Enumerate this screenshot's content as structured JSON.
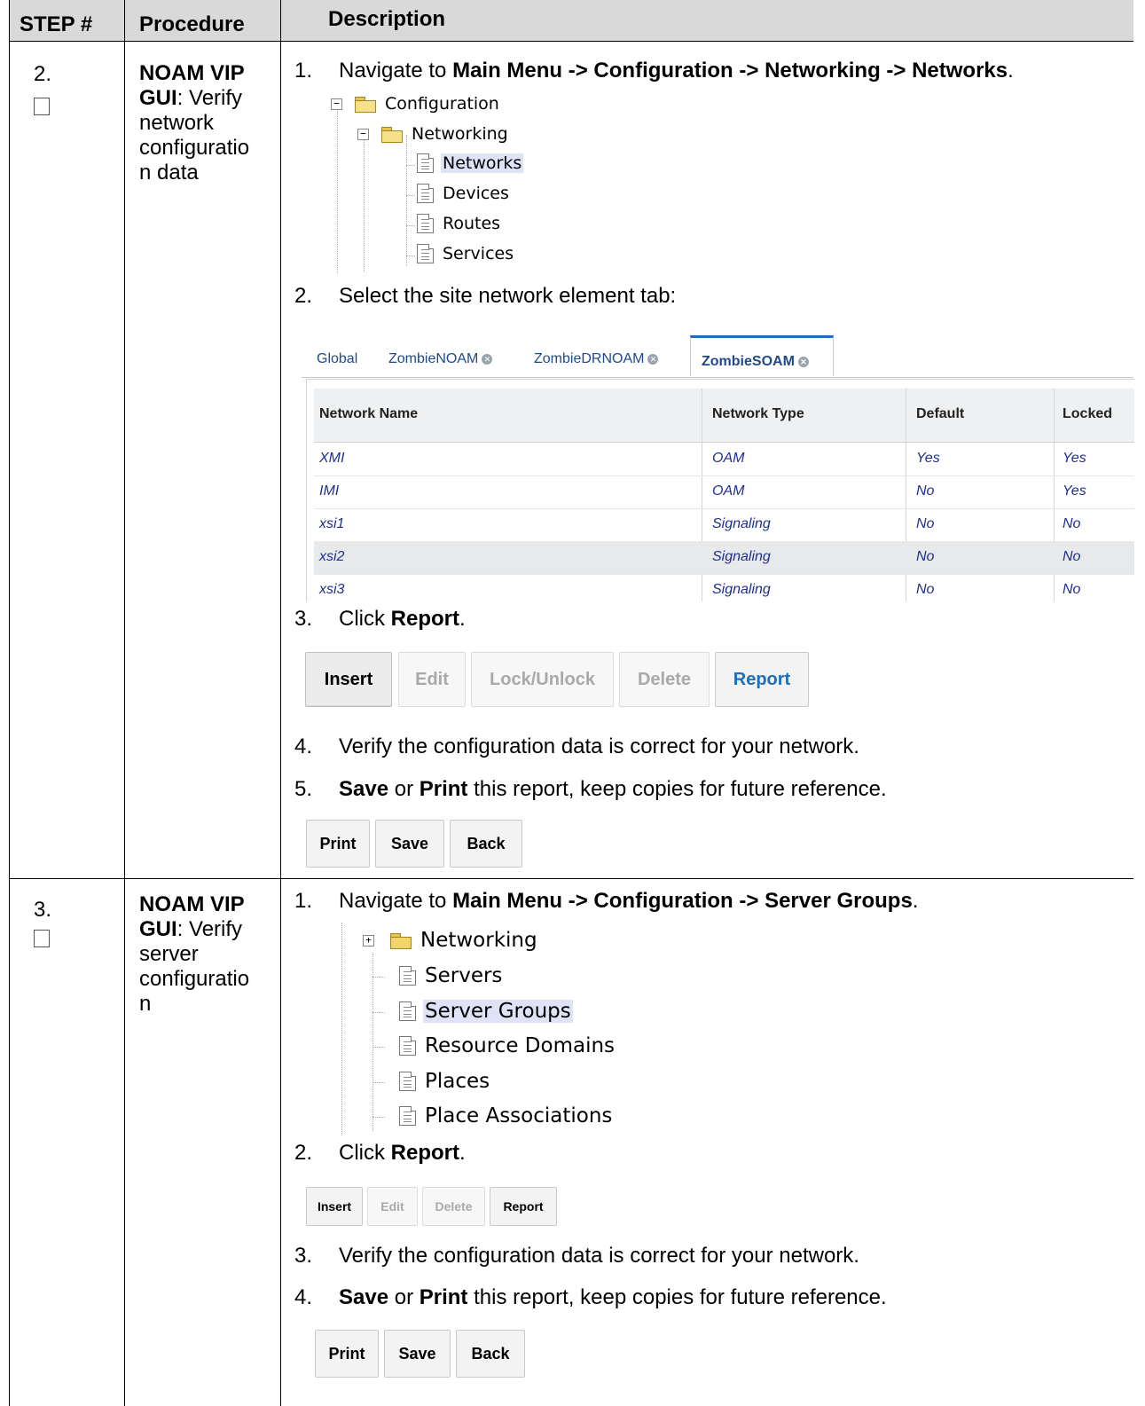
{
  "header": {
    "step": "STEP #",
    "procedure": "Procedure",
    "description": "Description"
  },
  "steps": [
    {
      "number": "2.",
      "procedure_bold": "NOAM VIP GUI",
      "procedure_rest": ": Verify network configuratio n data",
      "instructions": [
        {
          "num": "1.",
          "pre": "Navigate to ",
          "bold": "Main Menu -> Configuration -> Networking -> Networks",
          "post": "."
        },
        {
          "num": "2.",
          "pre": "Select the site network element tab:",
          "bold": "",
          "post": ""
        },
        {
          "num": "3.",
          "pre": "Click ",
          "bold": "Report",
          "post": "."
        },
        {
          "num": "4.",
          "pre": "Verify the configuration data is correct for your network.",
          "bold": "",
          "post": ""
        },
        {
          "num": "5.",
          "bold1": "Save",
          "mid1": " or ",
          "bold2": "Print",
          "post": " this report, keep copies for future reference."
        }
      ],
      "tree": {
        "root": "Configuration",
        "folder": "Networking",
        "items": [
          "Networks",
          "Devices",
          "Routes",
          "Services"
        ],
        "selected": "Networks"
      },
      "tabs": [
        "Global",
        "ZombieNOAM",
        "ZombieDRNOAM",
        "ZombieSOAM"
      ],
      "active_tab": "ZombieSOAM",
      "table": {
        "columns": [
          "Network Name",
          "Network Type",
          "Default",
          "Locked"
        ],
        "rows": [
          [
            "XMI",
            "OAM",
            "Yes",
            "Yes"
          ],
          [
            "IMI",
            "OAM",
            "No",
            "Yes"
          ],
          [
            "xsi1",
            "Signaling",
            "No",
            "No"
          ],
          [
            "xsi2",
            "Signaling",
            "No",
            "No"
          ],
          [
            "xsi3",
            "Signaling",
            "No",
            "No"
          ]
        ]
      },
      "buttons": [
        "Insert",
        "Edit",
        "Lock/Unlock",
        "Delete",
        "Report"
      ],
      "report_buttons": [
        "Print",
        "Save",
        "Back"
      ]
    },
    {
      "number": "3.",
      "procedure_bold": "NOAM VIP GUI",
      "procedure_rest": ": Verify server configuratio n",
      "instructions": [
        {
          "num": "1.",
          "pre": "Navigate to ",
          "bold": "Main Menu -> Configuration -> Server Groups",
          "post": "."
        },
        {
          "num": "2.",
          "pre": "Click ",
          "bold": "Report",
          "post": "."
        },
        {
          "num": "3.",
          "pre": "Verify the configuration data is correct for your network.",
          "bold": "",
          "post": ""
        },
        {
          "num": "4.",
          "bold1": "Save",
          "mid1": " or ",
          "bold2": "Print",
          "post": " this report, keep copies for future reference."
        }
      ],
      "tree": {
        "folder": "Networking",
        "items": [
          "Servers",
          "Server Groups",
          "Resource Domains",
          "Places",
          "Place Associations"
        ],
        "selected": "Server Groups"
      },
      "buttons": [
        "Insert",
        "Edit",
        "Delete",
        "Report"
      ],
      "report_buttons": [
        "Print",
        "Save",
        "Back"
      ]
    }
  ]
}
